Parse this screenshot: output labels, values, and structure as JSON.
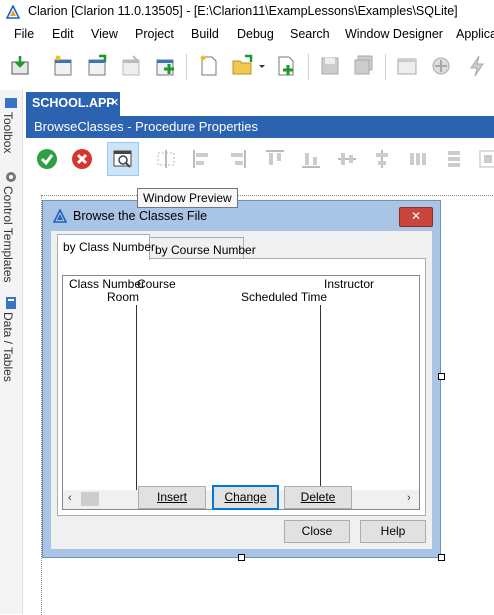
{
  "app": {
    "title": "Clarion [Clarion 11.0.13505] - [E:\\Clarion11\\ExampLessons\\Examples\\SQLite]"
  },
  "menu": [
    "File",
    "Edit",
    "View",
    "Project",
    "Build",
    "Debug",
    "Search",
    "Window Designer",
    "Applica"
  ],
  "side_tabs": {
    "toolbox": "Toolbox",
    "control_templates": "Control Templates",
    "data_tables": "Data / Tables"
  },
  "doc_tab": {
    "label": "SCHOOL.APP",
    "close": "✕"
  },
  "procedure_header": "BrowseClasses - Procedure Properties",
  "tooltip": "Window Preview",
  "window": {
    "title": "Browse the Classes File",
    "close": "✕",
    "tabs": [
      "by Class Number",
      "by Course Number"
    ],
    "list": {
      "headers": {
        "class_number": "Class Number",
        "room": "Room",
        "course": "Course",
        "scheduled_time": "Scheduled Time",
        "instructor": "Instructor"
      },
      "scroll_left": "‹",
      "scroll_right": "›"
    },
    "buttons": {
      "insert": "Insert",
      "change": "Change",
      "delete": "Delete",
      "close": "Close",
      "help": "Help"
    }
  },
  "colors": {
    "accent": "#2b63b0",
    "window_frame": "#a9c5e6",
    "close_red": "#c9463d"
  }
}
